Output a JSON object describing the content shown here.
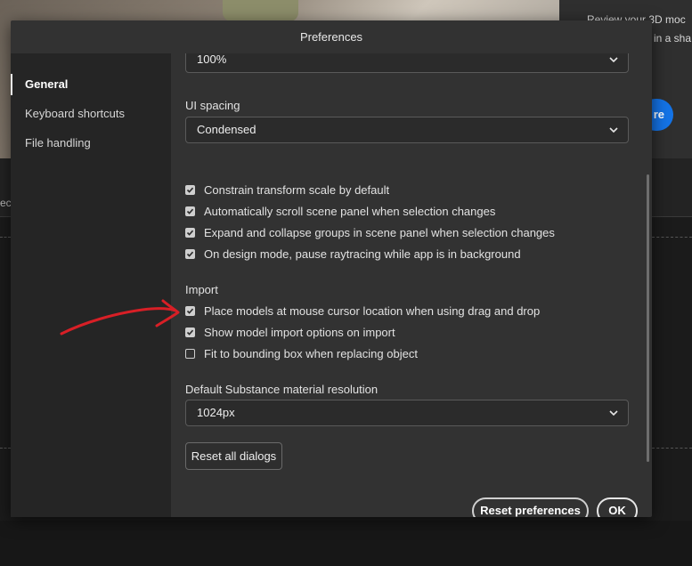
{
  "background": {
    "right_text_line1": "Review your 3D moc",
    "right_text_line2": "in a sha",
    "blue_button_label": "re",
    "tab_fragment": "ec"
  },
  "dialog": {
    "title": "Preferences",
    "sidebar": {
      "items": [
        {
          "label": "General",
          "active": true
        },
        {
          "label": "Keyboard shortcuts",
          "active": false
        },
        {
          "label": "File handling",
          "active": false
        }
      ]
    },
    "ui_scale": {
      "value": "100%"
    },
    "ui_spacing": {
      "label": "UI spacing",
      "value": "Condensed"
    },
    "options": [
      {
        "label": "Constrain transform scale by default",
        "checked": true
      },
      {
        "label": "Automatically scroll scene panel when selection changes",
        "checked": true
      },
      {
        "label": "Expand and collapse groups in scene panel when selection changes",
        "checked": true
      },
      {
        "label": "On design mode, pause raytracing while app is in background",
        "checked": true
      }
    ],
    "import": {
      "heading": "Import",
      "options": [
        {
          "label": "Place models at mouse cursor location when using drag and drop",
          "checked": true
        },
        {
          "label": "Show model import options on import",
          "checked": true
        },
        {
          "label": "Fit to bounding box when replacing object",
          "checked": false
        }
      ]
    },
    "material_resolution": {
      "label": "Default Substance material resolution",
      "value": "1024px"
    },
    "reset_dialogs_label": "Reset all dialogs",
    "reset_preferences_label": "Reset preferences",
    "ok_label": "OK"
  },
  "colors": {
    "dialog_bg": "#323232",
    "sidebar_bg": "#252525",
    "annotation_red": "#d81f26",
    "accent_blue": "#1473e6"
  },
  "icons": {
    "dropdown": "chevron-down-icon",
    "checkbox_checked": "checkmark-icon"
  }
}
